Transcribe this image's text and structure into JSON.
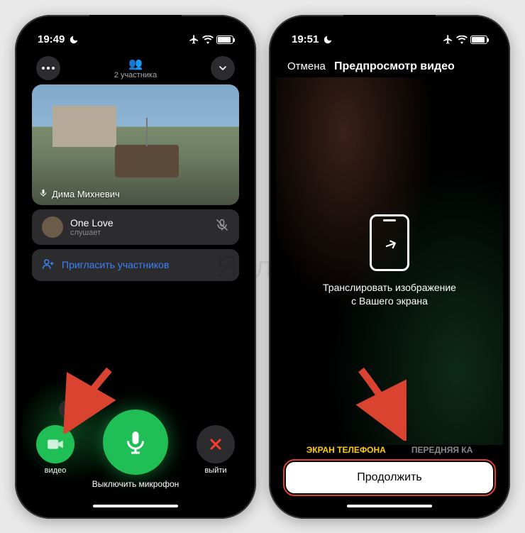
{
  "left": {
    "status": {
      "time": "19:49"
    },
    "header": {
      "participants_count": "2 участника"
    },
    "video": {
      "participant_name": "Дима Михневич"
    },
    "listener": {
      "name": "One Love",
      "status": "слушает"
    },
    "invite_label": "Пригласить участников",
    "controls": {
      "video_label": "видео",
      "mic_label": "Выключить микрофон",
      "exit_label": "выйти"
    }
  },
  "right": {
    "status": {
      "time": "19:51"
    },
    "cancel_label": "Отмена",
    "title": "Предпросмотр видео",
    "cast_line1": "Транслировать изображение",
    "cast_line2": "с Вашего экрана",
    "source_active": "ЭКРАН ТЕЛЕФОНА",
    "source_inactive": "ПЕРЕДНЯЯ КА",
    "continue_label": "Продолжить"
  },
  "watermark": "Яблык"
}
